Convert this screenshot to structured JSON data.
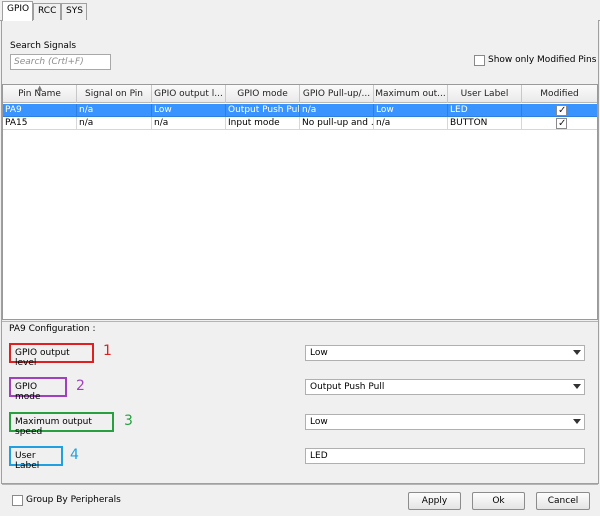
{
  "tabs": [
    {
      "label": "GPIO"
    },
    {
      "label": "RCC"
    },
    {
      "label": "SYS"
    }
  ],
  "search": {
    "label": "Search Signals",
    "placeholder": "Search (Crtl+F)"
  },
  "show_modified": {
    "label": "Show only Modified Pins",
    "checked": false
  },
  "table": {
    "columns": [
      "Pin Name",
      "Signal on Pin",
      "GPIO output l...",
      "GPIO mode",
      "GPIO Pull-up/...",
      "Maximum out...",
      "User Label",
      "Modified"
    ],
    "rows": [
      {
        "pin": "PA9",
        "signal": "n/a",
        "output_level": "Low",
        "mode": "Output Push Pull",
        "pull": "n/a",
        "speed": "Low",
        "label": "LED",
        "modified": true,
        "selected": true
      },
      {
        "pin": "PA15",
        "signal": "n/a",
        "output_level": "n/a",
        "mode": "Input mode",
        "pull": "No pull-up and ...",
        "speed": "n/a",
        "label": "BUTTON",
        "modified": true,
        "selected": false
      }
    ]
  },
  "config": {
    "title": "PA9 Configuration :",
    "fields": [
      {
        "label": "GPIO output level",
        "number": "1",
        "value": "Low",
        "type": "select"
      },
      {
        "label": "GPIO mode",
        "number": "2",
        "value": "Output Push Pull",
        "type": "select"
      },
      {
        "label": "Maximum output speed",
        "number": "3",
        "value": "Low",
        "type": "select"
      },
      {
        "label": "User Label",
        "number": "4",
        "value": "LED",
        "type": "text"
      }
    ]
  },
  "footer": {
    "group_label": "Group By Peripherals",
    "apply": "Apply",
    "ok": "Ok",
    "cancel": "Cancel"
  },
  "colors": {
    "selection": "#3a94ff",
    "red": "#e02020",
    "purple": "#a040c0",
    "green": "#28a040",
    "blue": "#20a0e0"
  }
}
